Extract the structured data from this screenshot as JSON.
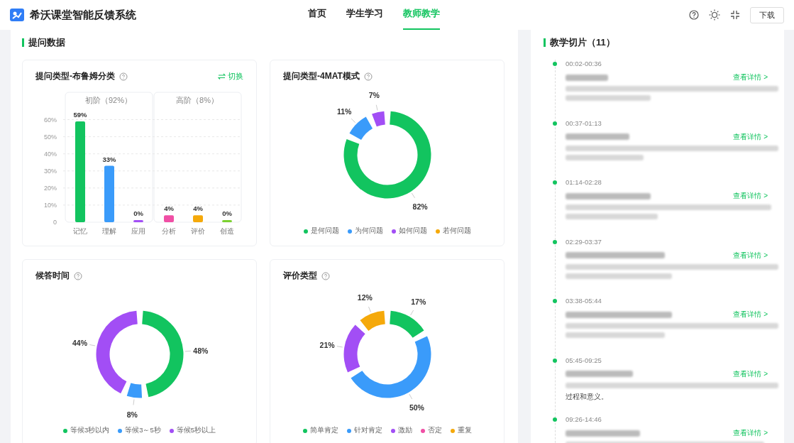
{
  "header": {
    "title": "希沃课堂智能反馈系统",
    "nav": [
      {
        "label": "首页",
        "selected": false
      },
      {
        "label": "学生学习",
        "selected": false
      },
      {
        "label": "教师教学",
        "selected": true
      }
    ],
    "download": "下载"
  },
  "section_title": "提问数据",
  "bloom_card": {
    "title": "提问类型-布鲁姆分类",
    "switch": "切换",
    "groups": [
      {
        "label": "初阶（92%）"
      },
      {
        "label": "高阶（8%）"
      }
    ],
    "chart_data": {
      "type": "bar",
      "categories": [
        "记忆",
        "理解",
        "应用",
        "分析",
        "评价",
        "创造"
      ],
      "values": [
        59,
        33,
        0,
        4,
        4,
        0
      ],
      "ylim": [
        0,
        76
      ],
      "grid": true,
      "colors": [
        "#12c45f",
        "#3a9bfa",
        "#a24ef5",
        "#f04fa5",
        "#f5a90a",
        "#7bd12f"
      ],
      "yticks": [
        {
          "value": 0,
          "label": "0"
        },
        {
          "value": 10,
          "label": "10%"
        },
        {
          "value": 20,
          "label": "20%"
        },
        {
          "value": 30,
          "label": "30%"
        },
        {
          "value": 40,
          "label": "40%"
        },
        {
          "value": 50,
          "label": "50%"
        },
        {
          "value": 60,
          "label": "60%"
        }
      ],
      "value_labels": [
        "59%",
        "33%",
        "0%",
        "4%",
        "4%",
        "0%"
      ]
    }
  },
  "donut_cards": [
    {
      "title": "提问类型-4MAT模式",
      "chart_data": {
        "type": "donut",
        "categories": [
          "是何问题",
          "为何问题",
          "如何问题",
          "若何问题"
        ],
        "colors": [
          "#12c45f",
          "#3a9bfa",
          "#a24ef5",
          "#f5a90a"
        ],
        "values": [
          82,
          11,
          7,
          0
        ],
        "value_labels": [
          "82%",
          "11%",
          "7%",
          null
        ]
      }
    },
    {
      "title": "候答时间",
      "chart_data": {
        "type": "donut",
        "categories": [
          "等候3秒以内",
          "等候3～5秒",
          "等候5秒以上"
        ],
        "colors": [
          "#12c45f",
          "#3a9bfa",
          "#a24ef5"
        ],
        "values": [
          48,
          8,
          44
        ],
        "value_labels": [
          "48%",
          "8%",
          "44%"
        ]
      }
    },
    {
      "title": "评价类型",
      "chart_data": {
        "type": "donut",
        "categories": [
          "简单肯定",
          "针对肯定",
          "激励",
          "否定",
          "重复"
        ],
        "colors": [
          "#12c45f",
          "#3a9bfa",
          "#a24ef5",
          "#f04fa5",
          "#f5a90a"
        ],
        "values": [
          17,
          50,
          21,
          0,
          12
        ],
        "value_labels": [
          "17%",
          "50%",
          "21%",
          null,
          "12%"
        ]
      }
    }
  ],
  "clips": {
    "title": "教学切片（11）",
    "items": [
      {
        "time": "00:02-00:36",
        "link": "查看详情 >"
      },
      {
        "time": "00:37-01:13",
        "link": "查看详情 >"
      },
      {
        "time": "01:14-02:28",
        "link": "查看详情 >"
      },
      {
        "time": "02:29-03:37",
        "link": "查看详情 >"
      },
      {
        "time": "03:38-05:44",
        "link": "查看详情 >"
      },
      {
        "time": "05:45-09:25",
        "link": "查看详情 >",
        "desc_tail": "过程和意义。"
      },
      {
        "time": "09:26-14:46",
        "link": "查看详情 >"
      }
    ]
  }
}
